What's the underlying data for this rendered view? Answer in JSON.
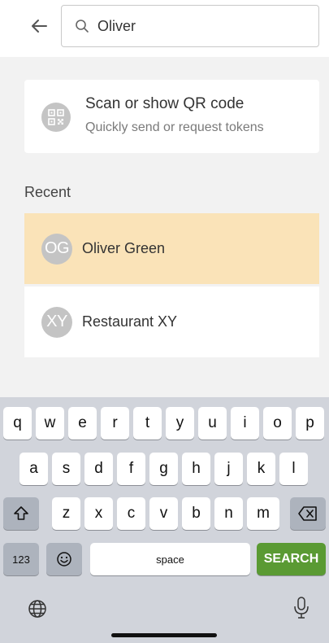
{
  "search": {
    "value": "Oliver",
    "icon": "search-icon"
  },
  "header": {
    "back_icon": "arrow-left-icon"
  },
  "qr": {
    "title": "Scan or show QR code",
    "subtitle": "Quickly send or request tokens",
    "icon": "qr-code-icon"
  },
  "recent": {
    "label": "Recent",
    "contacts": [
      {
        "initials": "OG",
        "name": "Oliver Green",
        "selected": true
      },
      {
        "initials": "XY",
        "name": "Restaurant XY",
        "selected": false
      }
    ]
  },
  "keyboard": {
    "row1": [
      "q",
      "w",
      "e",
      "r",
      "t",
      "y",
      "u",
      "i",
      "o",
      "p"
    ],
    "row2": [
      "a",
      "s",
      "d",
      "f",
      "g",
      "h",
      "j",
      "k",
      "l"
    ],
    "row3": [
      "z",
      "x",
      "c",
      "v",
      "b",
      "n",
      "m"
    ],
    "numbers_label": "123",
    "space_label": "space",
    "action_label": "SEARCH",
    "icons": {
      "shift": "shift-icon",
      "delete": "backspace-icon",
      "emoji": "emoji-icon",
      "globe": "globe-icon",
      "mic": "microphone-icon"
    }
  },
  "colors": {
    "selected_row": "#fae3b8",
    "action_key": "#5a9a33",
    "avatar": "#c4c4c4",
    "page_background": "#f2f2f2"
  }
}
